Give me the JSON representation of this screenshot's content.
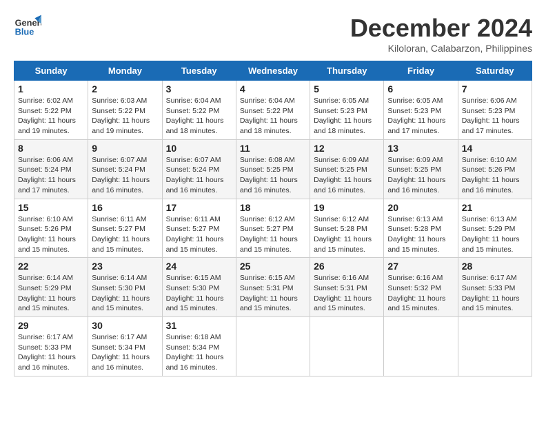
{
  "header": {
    "logo_line1": "General",
    "logo_line2": "Blue",
    "title": "December 2024",
    "subtitle": "Kiloloran, Calabarzon, Philippines"
  },
  "calendar": {
    "days_of_week": [
      "Sunday",
      "Monday",
      "Tuesday",
      "Wednesday",
      "Thursday",
      "Friday",
      "Saturday"
    ],
    "weeks": [
      [
        null,
        null,
        null,
        null,
        null,
        null,
        null
      ]
    ]
  },
  "cells": {
    "w1": [
      {
        "day": "1",
        "sunrise": "6:02 AM",
        "sunset": "5:22 PM",
        "daylight": "11 hours and 19 minutes."
      },
      {
        "day": "2",
        "sunrise": "6:03 AM",
        "sunset": "5:22 PM",
        "daylight": "11 hours and 19 minutes."
      },
      {
        "day": "3",
        "sunrise": "6:04 AM",
        "sunset": "5:22 PM",
        "daylight": "11 hours and 18 minutes."
      },
      {
        "day": "4",
        "sunrise": "6:04 AM",
        "sunset": "5:22 PM",
        "daylight": "11 hours and 18 minutes."
      },
      {
        "day": "5",
        "sunrise": "6:05 AM",
        "sunset": "5:23 PM",
        "daylight": "11 hours and 18 minutes."
      },
      {
        "day": "6",
        "sunrise": "6:05 AM",
        "sunset": "5:23 PM",
        "daylight": "11 hours and 17 minutes."
      },
      {
        "day": "7",
        "sunrise": "6:06 AM",
        "sunset": "5:23 PM",
        "daylight": "11 hours and 17 minutes."
      }
    ],
    "w2": [
      {
        "day": "8",
        "sunrise": "6:06 AM",
        "sunset": "5:24 PM",
        "daylight": "11 hours and 17 minutes."
      },
      {
        "day": "9",
        "sunrise": "6:07 AM",
        "sunset": "5:24 PM",
        "daylight": "11 hours and 16 minutes."
      },
      {
        "day": "10",
        "sunrise": "6:07 AM",
        "sunset": "5:24 PM",
        "daylight": "11 hours and 16 minutes."
      },
      {
        "day": "11",
        "sunrise": "6:08 AM",
        "sunset": "5:25 PM",
        "daylight": "11 hours and 16 minutes."
      },
      {
        "day": "12",
        "sunrise": "6:09 AM",
        "sunset": "5:25 PM",
        "daylight": "11 hours and 16 minutes."
      },
      {
        "day": "13",
        "sunrise": "6:09 AM",
        "sunset": "5:25 PM",
        "daylight": "11 hours and 16 minutes."
      },
      {
        "day": "14",
        "sunrise": "6:10 AM",
        "sunset": "5:26 PM",
        "daylight": "11 hours and 16 minutes."
      }
    ],
    "w3": [
      {
        "day": "15",
        "sunrise": "6:10 AM",
        "sunset": "5:26 PM",
        "daylight": "11 hours and 15 minutes."
      },
      {
        "day": "16",
        "sunrise": "6:11 AM",
        "sunset": "5:27 PM",
        "daylight": "11 hours and 15 minutes."
      },
      {
        "day": "17",
        "sunrise": "6:11 AM",
        "sunset": "5:27 PM",
        "daylight": "11 hours and 15 minutes."
      },
      {
        "day": "18",
        "sunrise": "6:12 AM",
        "sunset": "5:27 PM",
        "daylight": "11 hours and 15 minutes."
      },
      {
        "day": "19",
        "sunrise": "6:12 AM",
        "sunset": "5:28 PM",
        "daylight": "11 hours and 15 minutes."
      },
      {
        "day": "20",
        "sunrise": "6:13 AM",
        "sunset": "5:28 PM",
        "daylight": "11 hours and 15 minutes."
      },
      {
        "day": "21",
        "sunrise": "6:13 AM",
        "sunset": "5:29 PM",
        "daylight": "11 hours and 15 minutes."
      }
    ],
    "w4": [
      {
        "day": "22",
        "sunrise": "6:14 AM",
        "sunset": "5:29 PM",
        "daylight": "11 hours and 15 minutes."
      },
      {
        "day": "23",
        "sunrise": "6:14 AM",
        "sunset": "5:30 PM",
        "daylight": "11 hours and 15 minutes."
      },
      {
        "day": "24",
        "sunrise": "6:15 AM",
        "sunset": "5:30 PM",
        "daylight": "11 hours and 15 minutes."
      },
      {
        "day": "25",
        "sunrise": "6:15 AM",
        "sunset": "5:31 PM",
        "daylight": "11 hours and 15 minutes."
      },
      {
        "day": "26",
        "sunrise": "6:16 AM",
        "sunset": "5:31 PM",
        "daylight": "11 hours and 15 minutes."
      },
      {
        "day": "27",
        "sunrise": "6:16 AM",
        "sunset": "5:32 PM",
        "daylight": "11 hours and 15 minutes."
      },
      {
        "day": "28",
        "sunrise": "6:17 AM",
        "sunset": "5:33 PM",
        "daylight": "11 hours and 15 minutes."
      }
    ],
    "w5": [
      {
        "day": "29",
        "sunrise": "6:17 AM",
        "sunset": "5:33 PM",
        "daylight": "11 hours and 16 minutes."
      },
      {
        "day": "30",
        "sunrise": "6:17 AM",
        "sunset": "5:34 PM",
        "daylight": "11 hours and 16 minutes."
      },
      {
        "day": "31",
        "sunrise": "6:18 AM",
        "sunset": "5:34 PM",
        "daylight": "11 hours and 16 minutes."
      },
      null,
      null,
      null,
      null
    ]
  },
  "labels": {
    "sunrise_label": "Sunrise:",
    "sunset_label": "Sunset:",
    "daylight_label": "Daylight:"
  }
}
